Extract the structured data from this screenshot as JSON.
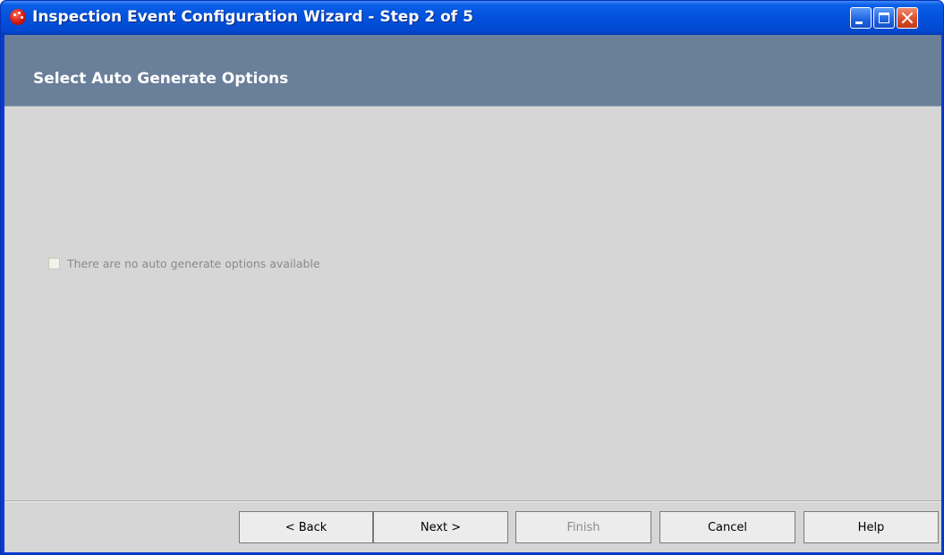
{
  "window": {
    "title": "Inspection Event Configuration Wizard - Step 2 of 5",
    "controls": [
      "minimize-icon",
      "maximize-icon",
      "close-icon"
    ]
  },
  "header": {
    "title": "Select Auto Generate Options"
  },
  "content": {
    "option": {
      "label": "There are no auto generate options available",
      "checked": false,
      "enabled": false
    }
  },
  "footer": {
    "back_label": "< Back",
    "next_label": "Next >",
    "finish_label": "Finish",
    "cancel_label": "Cancel",
    "help_label": "Help"
  },
  "colors": {
    "titlebar": "#0351dc",
    "header_band": "#6a7f9a",
    "body": "#d6d6d6"
  }
}
